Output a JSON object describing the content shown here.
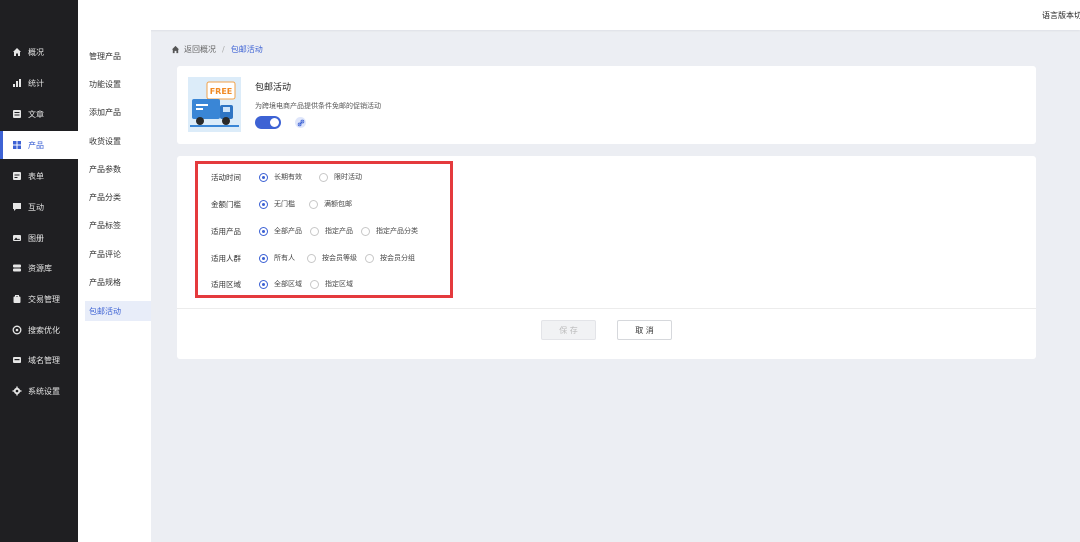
{
  "topbar": {
    "lang_label": "语言版本切"
  },
  "sidebar": {
    "items": [
      {
        "label": "概况",
        "icon": "home-icon"
      },
      {
        "label": "统计",
        "icon": "stats-icon"
      },
      {
        "label": "文章",
        "icon": "article-icon"
      },
      {
        "label": "产品",
        "icon": "product-icon"
      },
      {
        "label": "表单",
        "icon": "form-icon"
      },
      {
        "label": "互动",
        "icon": "chat-icon"
      },
      {
        "label": "图册",
        "icon": "album-icon"
      },
      {
        "label": "资源库",
        "icon": "database-icon"
      },
      {
        "label": "交易管理",
        "icon": "trade-icon"
      },
      {
        "label": "搜索优化",
        "icon": "seo-icon"
      },
      {
        "label": "域名管理",
        "icon": "domain-icon"
      },
      {
        "label": "系统设置",
        "icon": "gear-icon"
      }
    ],
    "active_index": 3
  },
  "submenu": {
    "items": [
      {
        "label": "管理产品"
      },
      {
        "label": "功能设置"
      },
      {
        "label": "添加产品"
      },
      {
        "label": "收货设置"
      },
      {
        "label": "产品参数"
      },
      {
        "label": "产品分类"
      },
      {
        "label": "产品标签"
      },
      {
        "label": "产品评论"
      },
      {
        "label": "产品规格"
      },
      {
        "label": "包邮活动"
      }
    ],
    "active_index": 9
  },
  "breadcrumb": {
    "back": "返回概况",
    "separator": "/",
    "current": "包邮活动"
  },
  "promo": {
    "image_text": "FREE",
    "title": "包邮活动",
    "description": "为跨境电商产品提供条件免邮的促销活动",
    "enabled": true
  },
  "form": {
    "rows": [
      {
        "label": "活动时间",
        "options": [
          "长期有效",
          "限时活动"
        ],
        "selected": 0
      },
      {
        "label": "金额门槛",
        "options": [
          "无门槛",
          "满额包邮"
        ],
        "selected": 0
      },
      {
        "label": "适用产品",
        "options": [
          "全部产品",
          "指定产品",
          "指定产品分类"
        ],
        "selected": 0
      },
      {
        "label": "适用人群",
        "options": [
          "所有人",
          "按会员等级",
          "按会员分组"
        ],
        "selected": 0
      },
      {
        "label": "适用区域",
        "options": [
          "全部区域",
          "指定区域"
        ],
        "selected": 0
      }
    ]
  },
  "buttons": {
    "save": "保 存",
    "cancel": "取 消"
  },
  "colors": {
    "accent": "#3d62d4",
    "highlight": "#e43a3d",
    "sidebar_bg": "#1f1f22"
  }
}
